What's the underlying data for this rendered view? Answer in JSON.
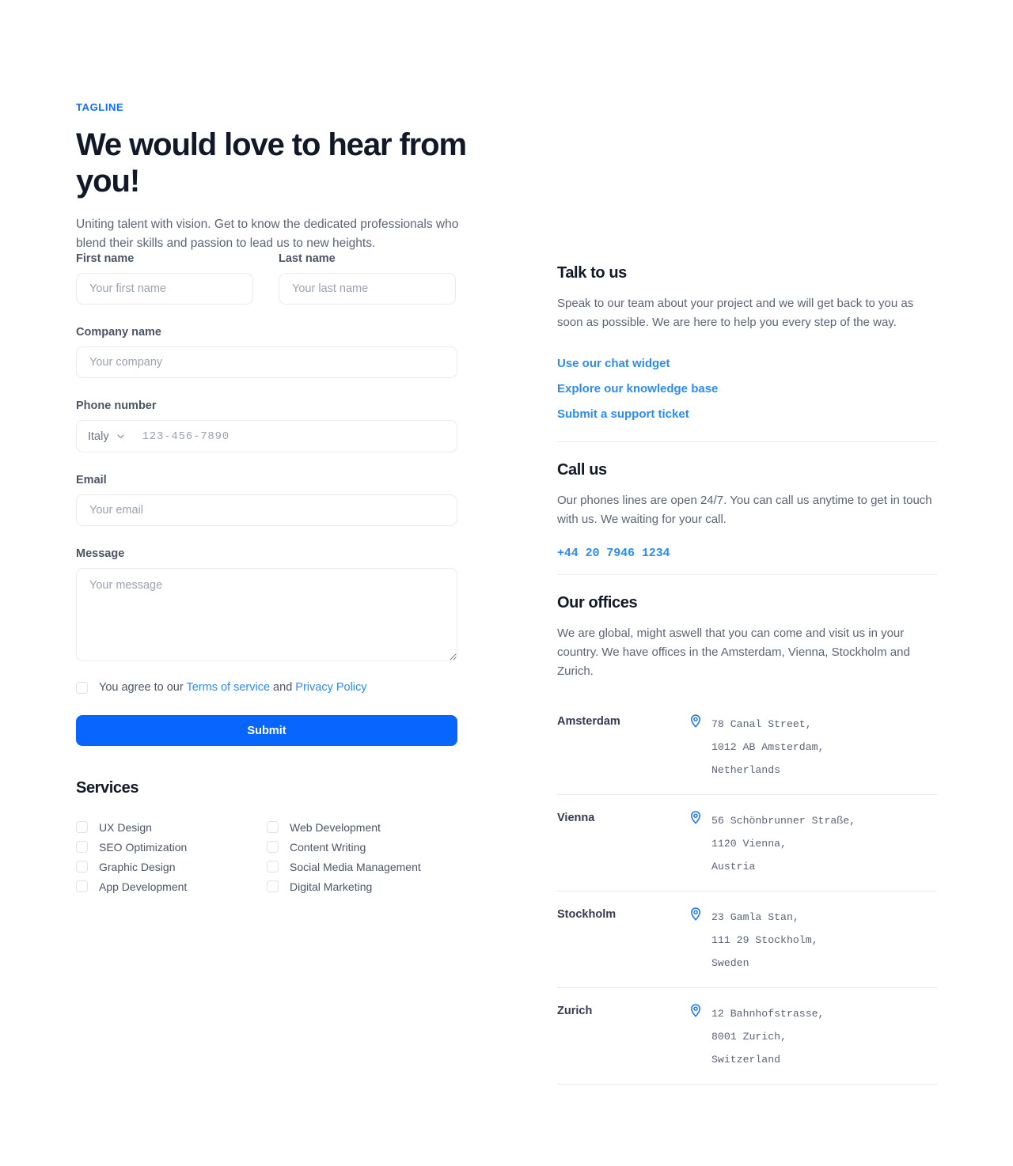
{
  "hero": {
    "tagline": "TAGLINE",
    "headline": "We would love to hear from you!",
    "subhead": "Uniting talent with vision. Get to know the dedicated professionals who blend their skills and passion to lead us to new heights."
  },
  "form": {
    "first_name": {
      "label": "First name",
      "placeholder": "Your first name",
      "value": ""
    },
    "last_name": {
      "label": "Last name",
      "placeholder": "Your last name",
      "value": ""
    },
    "company": {
      "label": "Company name",
      "placeholder": "Your company",
      "value": ""
    },
    "phone": {
      "label": "Phone number",
      "country": "Italy",
      "placeholder": "123-456-7890",
      "value": "",
      "chevron_icon": "chevron-down-icon"
    },
    "email": {
      "label": "Email",
      "placeholder": "Your email",
      "value": ""
    },
    "message": {
      "label": "Message",
      "placeholder": "Your message",
      "value": ""
    },
    "agree": {
      "checked": false,
      "text_before": "You agree to our ",
      "terms_link": "Terms of service",
      "text_middle": " and ",
      "privacy_link": "Privacy Policy"
    },
    "submit_label": "Submit"
  },
  "services": {
    "title": "Services",
    "column_left": [
      {
        "label": "UX Design",
        "checked": false
      },
      {
        "label": "SEO Optimization",
        "checked": false
      },
      {
        "label": "Graphic Design",
        "checked": false
      },
      {
        "label": "App Development",
        "checked": false
      }
    ],
    "column_right": [
      {
        "label": "Web Development",
        "checked": false
      },
      {
        "label": "Content Writing",
        "checked": false
      },
      {
        "label": "Social Media Management",
        "checked": false
      },
      {
        "label": "Digital Marketing",
        "checked": false
      }
    ]
  },
  "talk_to_us": {
    "title": "Talk to us",
    "body": "Speak to our team about your project and we will get back to you as soon as possible. We are here to help you every step of the way.",
    "links": [
      "Use our chat widget",
      "Explore our knowledge base",
      "Submit a support ticket"
    ]
  },
  "call_us": {
    "title": "Call us",
    "body": "Our phones lines are open 24/7. You can call us anytime to get in touch with us. We waiting for your call.",
    "phone": "+44 20 7946 1234"
  },
  "our_offices": {
    "title": "Our offices",
    "body": "We are global, might aswell that you can come and visit us in your country. We have offices in the Amsterdam, Vienna, Stockholm and Zurich.",
    "pin_icon": "map-pin-icon",
    "list": [
      {
        "city": "Amsterdam",
        "line1": "78 Canal Street,",
        "line2": "1012 AB Amsterdam,",
        "line3": "Netherlands"
      },
      {
        "city": "Vienna",
        "line1": "56 Schönbrunner Straße,",
        "line2": "1120 Vienna,",
        "line3": "Austria"
      },
      {
        "city": "Stockholm",
        "line1": "23 Gamla Stan,",
        "line2": "111 29 Stockholm,",
        "line3": "Sweden"
      },
      {
        "city": "Zurich",
        "line1": "12 Bahnhofstrasse,",
        "line2": "8001 Zurich,",
        "line3": "Switzerland"
      }
    ]
  },
  "colors": {
    "accent_blue": "#0866fe",
    "link_blue": "#2b8cf7",
    "tagline_blue": "#0d6efd",
    "heading_dark": "#111827",
    "body_gray": "#5b6475",
    "border_light": "#e9ebef"
  }
}
